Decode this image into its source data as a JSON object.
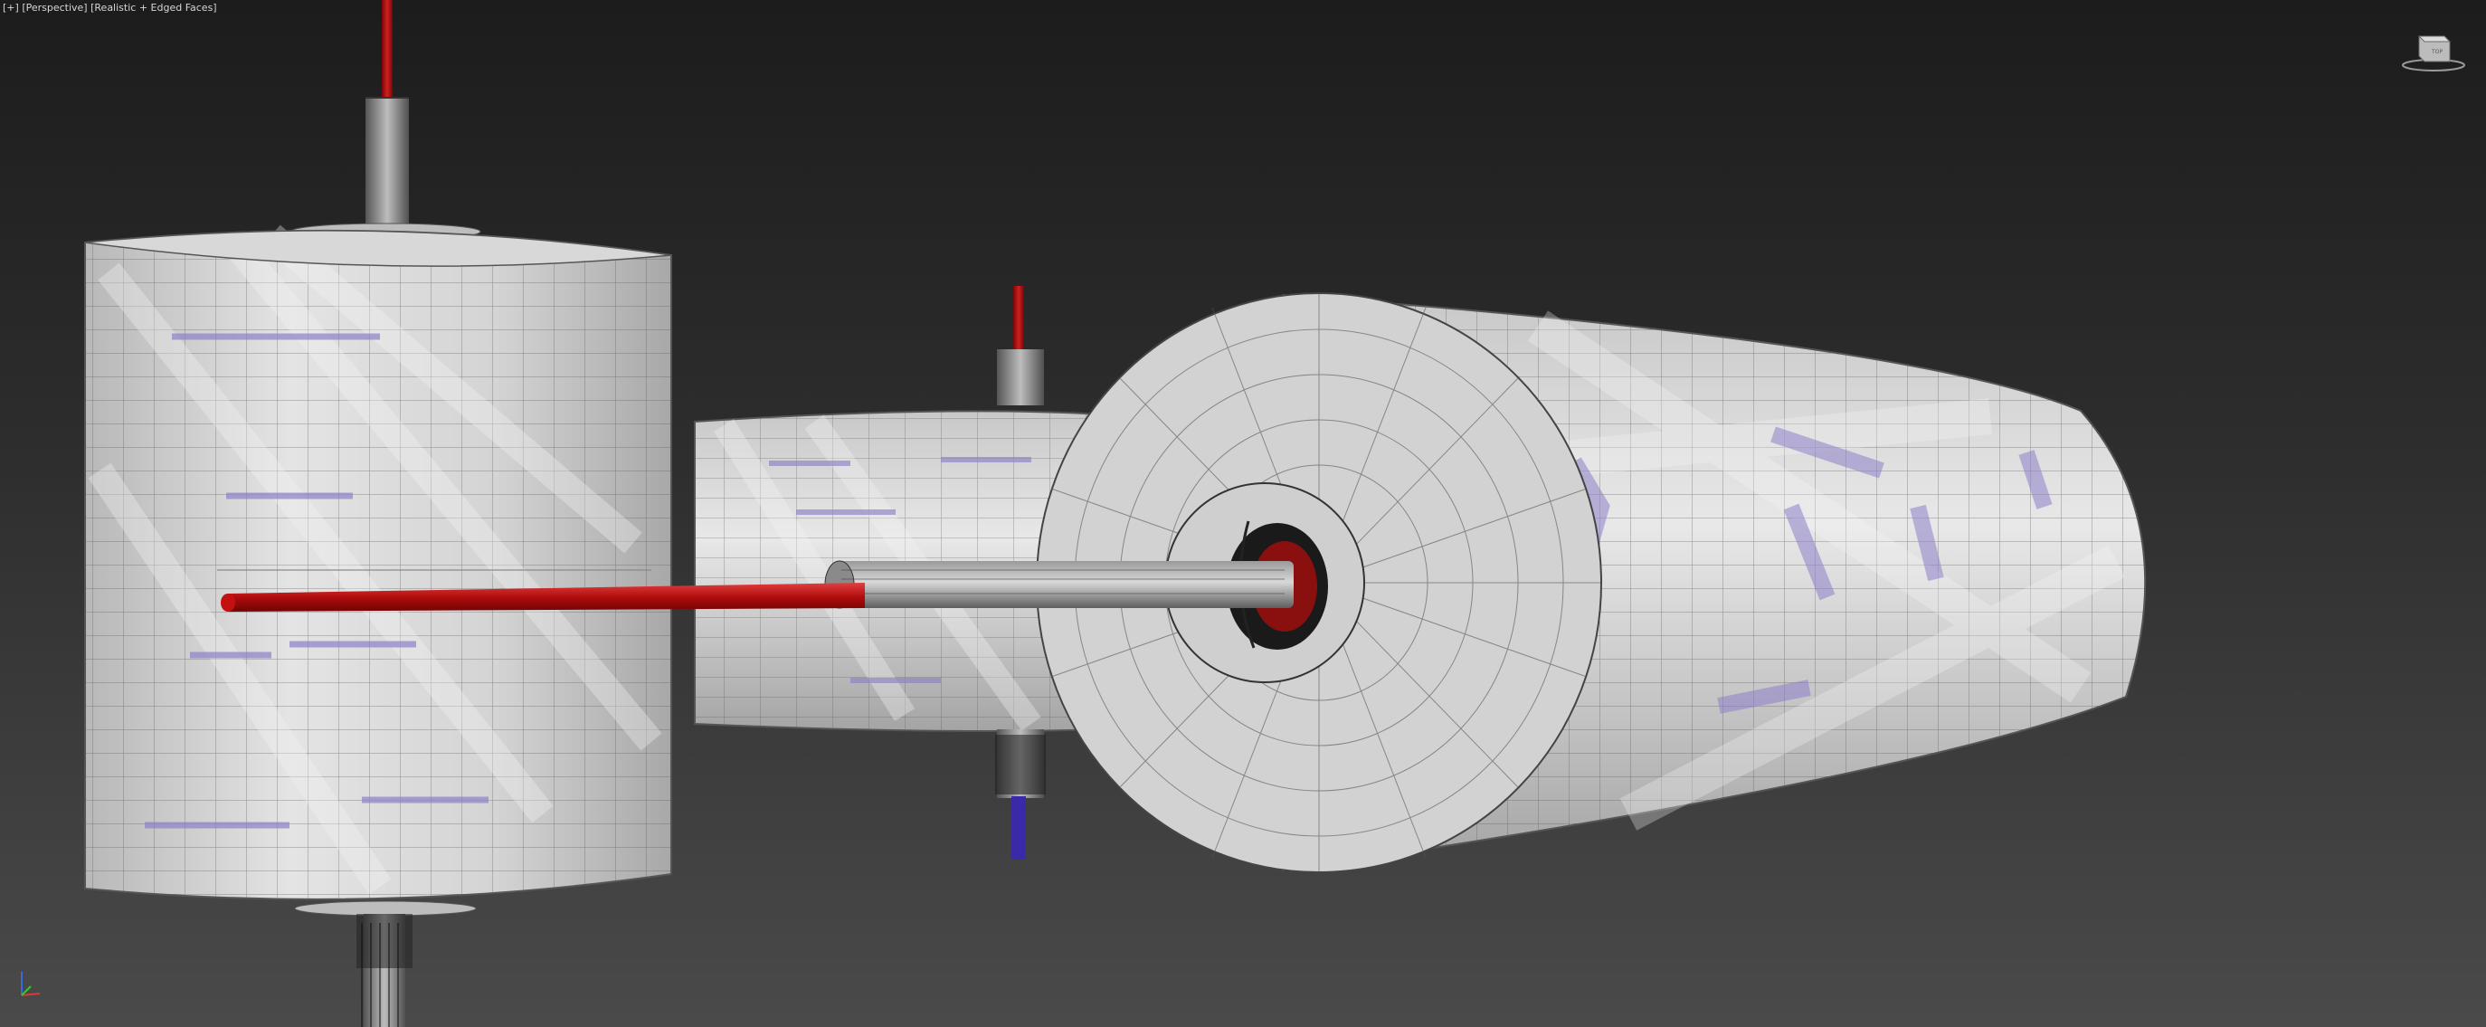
{
  "viewport": {
    "labels": {
      "menu": "[+]",
      "view": "[Perspective]",
      "shading": "[Realistic + Edged Faces]"
    },
    "separator": " "
  },
  "viewcube": {
    "face_label": "TOP",
    "icon": "viewcube-icon"
  },
  "axis_tripod": {
    "icon": "world-axis-tripod-icon",
    "x_color": "#d83a3a",
    "y_color": "#3ac23a",
    "z_color": "#3a6ad8"
  },
  "colors": {
    "shaft_red": "#c41010",
    "shaft_blue": "#3b2aa8",
    "mesh_face": "#cfcfcf",
    "wire": "#3a3a3a"
  }
}
